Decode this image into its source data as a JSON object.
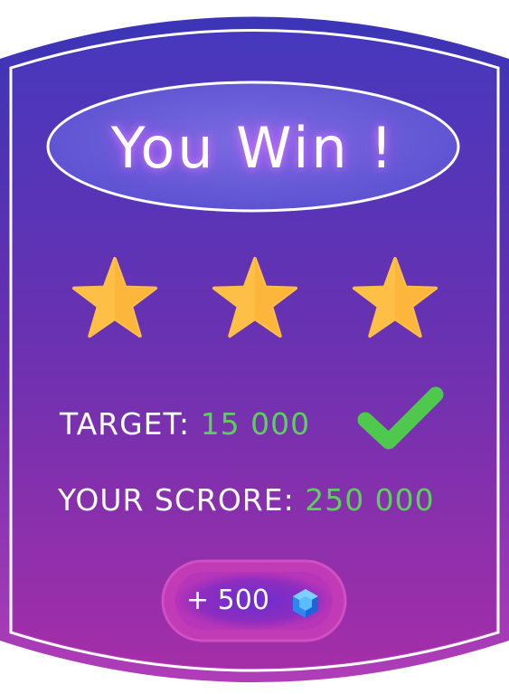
{
  "popup": {
    "title": "You Win !",
    "stars_earned": 3,
    "stars_total": 3,
    "target_label": "TARGET:",
    "target_value": "15 000",
    "target_status": "check-icon",
    "score_label": "YOUR SCRORE:",
    "score_value": "250 000",
    "reward_text": "+ 500",
    "reward_icon": "gem-icon"
  },
  "colors": {
    "frame_top": "#3c35b6",
    "frame_bottom": "#a83ab5",
    "panel_top": "#4b39bd",
    "panel_bottom": "#a52fa8",
    "title_oval": "#6f63dc",
    "star": "#fdbf45",
    "value_green": "#5bd15d",
    "check_green": "#4ec94d",
    "gem_blue": "#38a7ff"
  }
}
